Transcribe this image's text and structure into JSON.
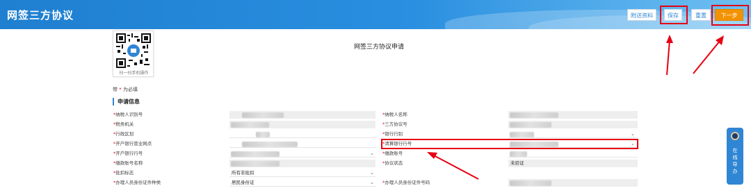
{
  "app": {
    "title": "网签三方协议"
  },
  "toolbar": {
    "attach_label": "附送资料",
    "save_label": "保存",
    "reset_label": "重置",
    "next_label": "下一步"
  },
  "qr": {
    "caption": "扫一扫手机操作"
  },
  "form": {
    "title": "网签三方协议申请",
    "required_prefix": "带",
    "required_suffix": "为必填",
    "section_title": "申请信息",
    "fields": [
      {
        "label": "纳税人识别号",
        "value": ""
      },
      {
        "label": "纳税人名称",
        "value": ""
      },
      {
        "label": "税务机关",
        "value": ""
      },
      {
        "label": "三方协议号",
        "value": ""
      },
      {
        "label": "行政区划",
        "value": ""
      },
      {
        "label": "银行行别",
        "value": ""
      },
      {
        "label": "开户银行营业网点",
        "value": ""
      },
      {
        "label": "清算银行行号",
        "value": ""
      },
      {
        "label": "开户银行行号",
        "value": ""
      },
      {
        "label": "缴款账号",
        "value": ""
      },
      {
        "label": "缴款账号名称",
        "value": ""
      },
      {
        "label": "协议状态",
        "value": "未验证"
      },
      {
        "label": "批扣标志",
        "value": "所有非批扣"
      },
      {
        "label": "办理人员身份证件种类",
        "value": "居民身份证"
      },
      {
        "label": "办理人员身份证件号码",
        "value": ""
      }
    ]
  },
  "side_guide": {
    "label": "在线导办"
  },
  "colors": {
    "primary": "#2f86d4",
    "accent": "#f39200",
    "annotation": "#e60012"
  }
}
